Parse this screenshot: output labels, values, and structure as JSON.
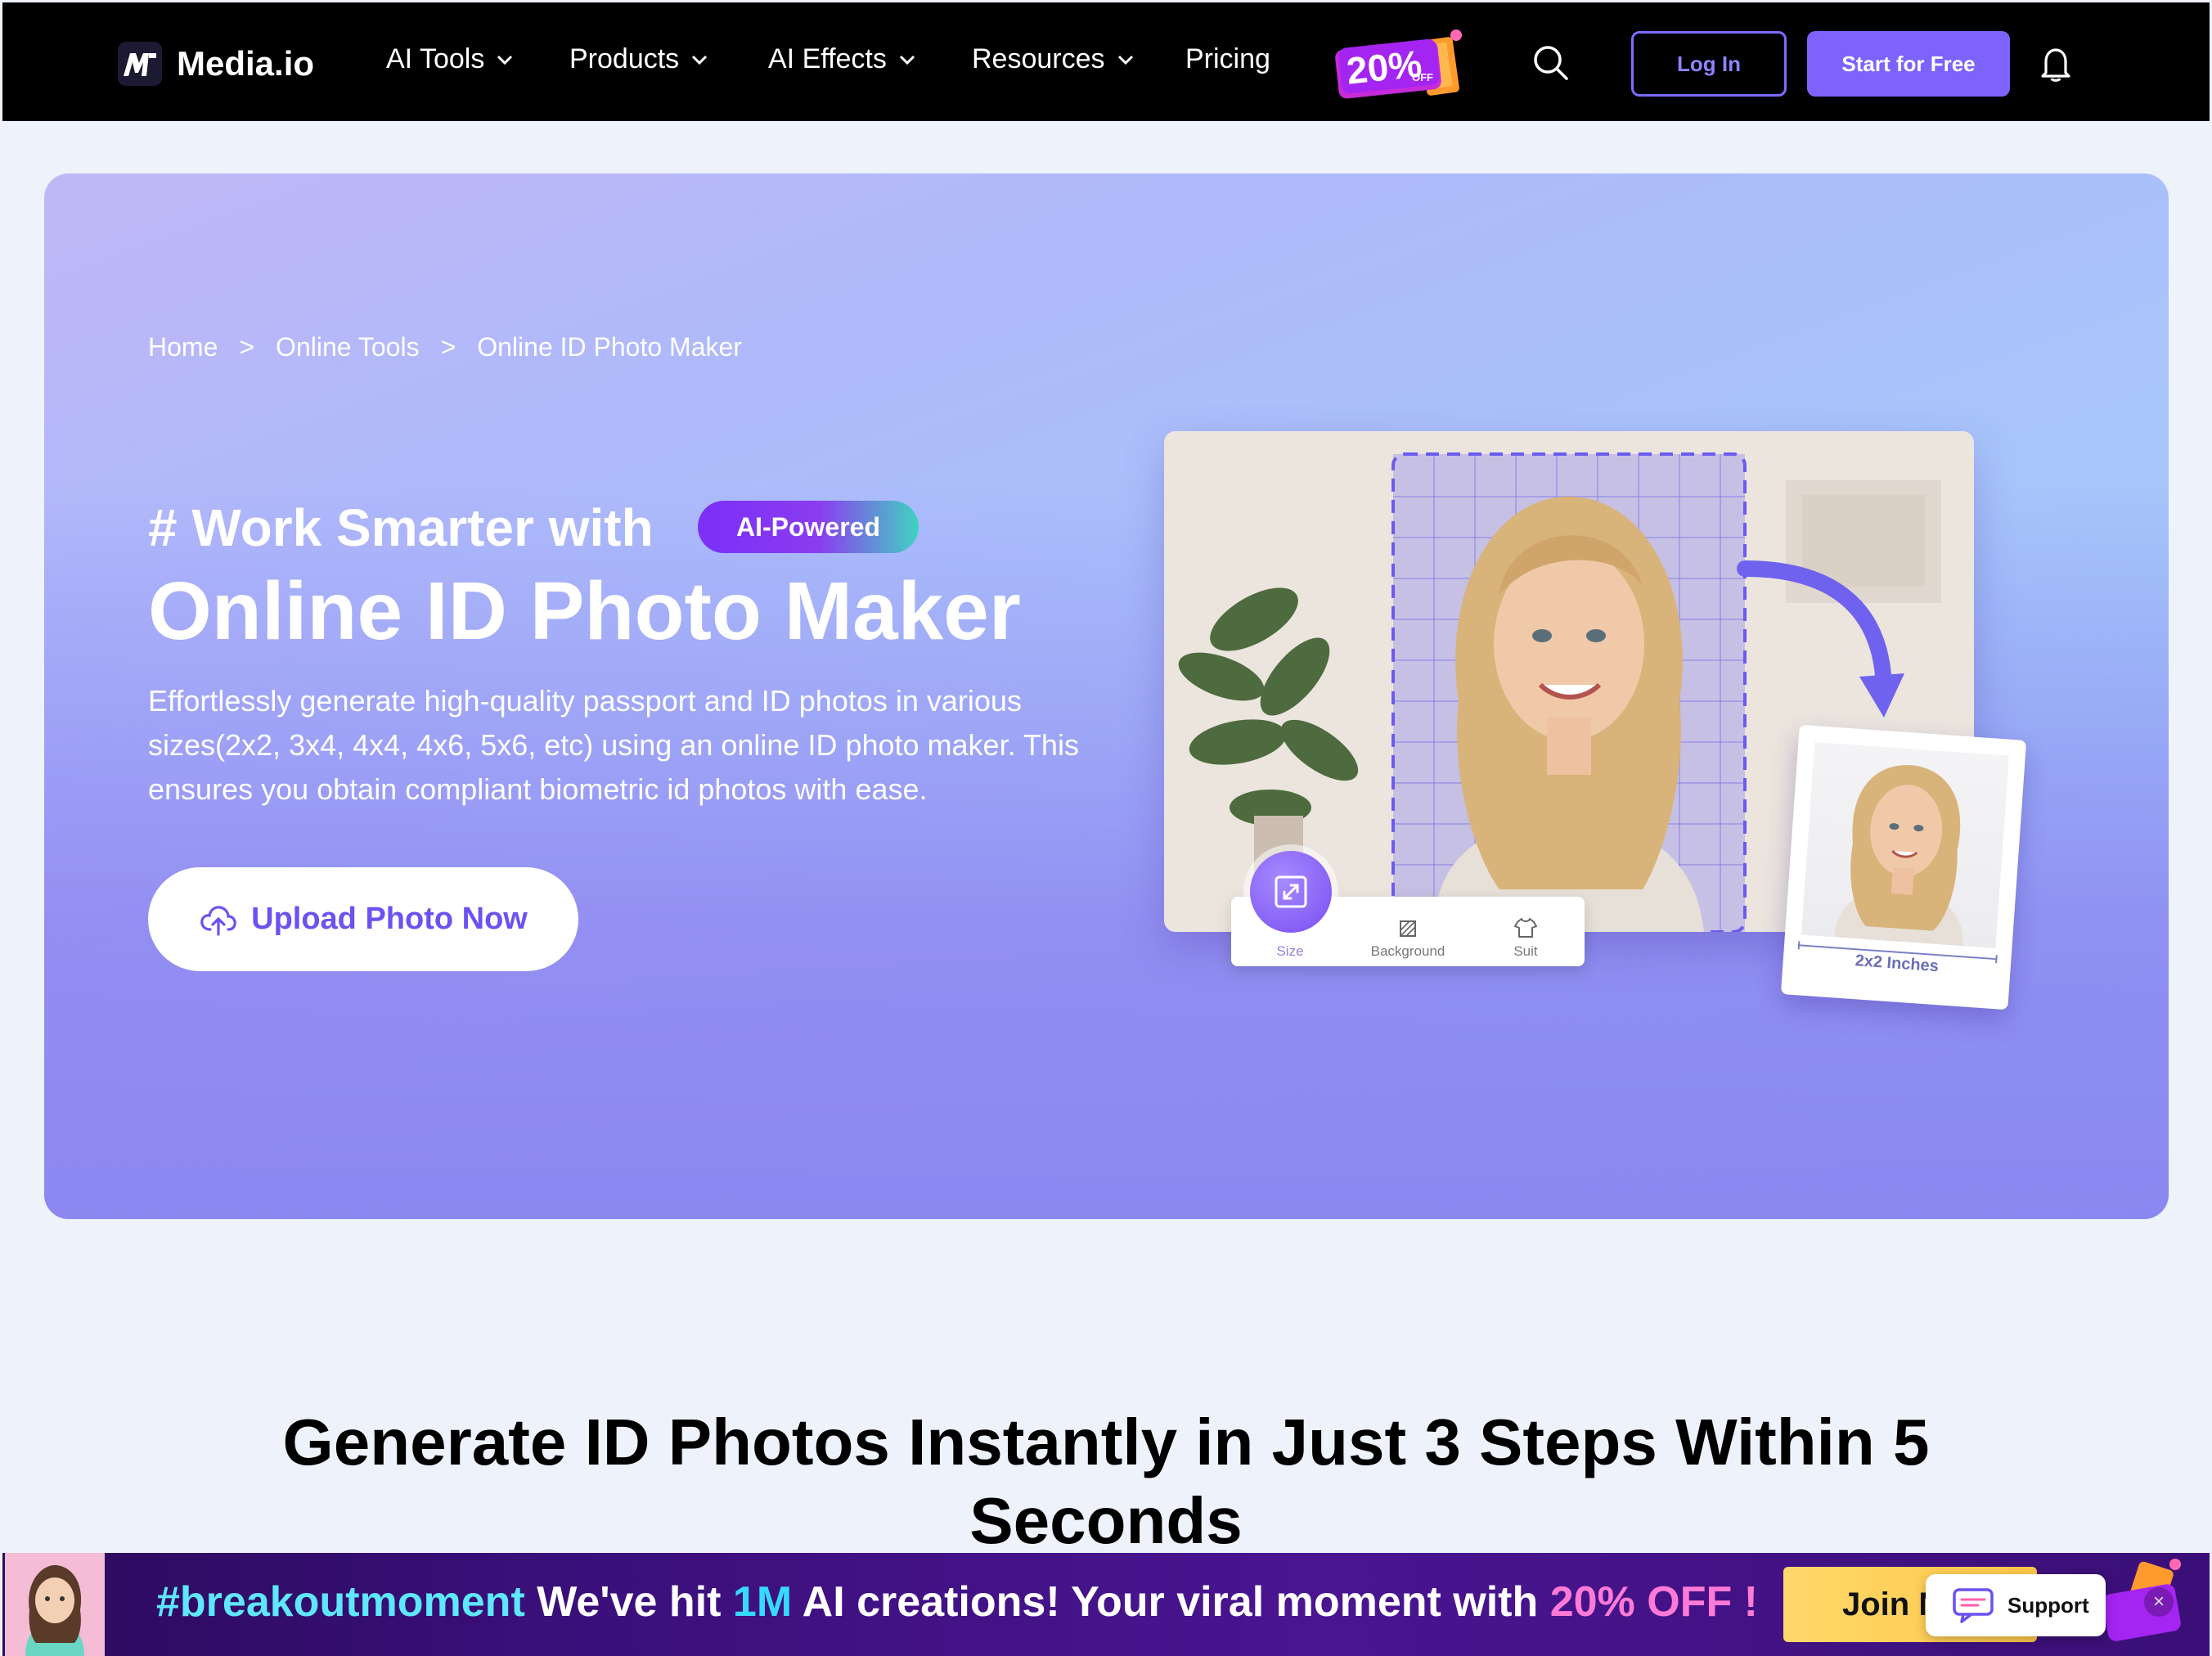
{
  "nav": {
    "logo_text": "Media.io",
    "items": [
      {
        "label": "AI Tools",
        "has_dropdown": true
      },
      {
        "label": "Products",
        "has_dropdown": true
      },
      {
        "label": "AI Effects",
        "has_dropdown": true
      },
      {
        "label": "Resources",
        "has_dropdown": true
      },
      {
        "label": "Pricing",
        "has_dropdown": false
      }
    ],
    "promo": {
      "percent": "20%",
      "off": "OFF"
    },
    "login_label": "Log In",
    "start_label": "Start for Free",
    "icons": [
      "search-icon",
      "bell-icon"
    ]
  },
  "hero": {
    "breadcrumb": [
      "Home",
      "Online Tools",
      "Online ID Photo Maker"
    ],
    "breadcrumb_sep": ">",
    "kicker": "# Work Smarter with",
    "badge": "AI-Powered",
    "title": "Online ID Photo Maker",
    "description": "Effortlessly generate high-quality passport and ID photos in various sizes(2x2, 3x4, 4x4, 4x6, 5x6, etc) using an online ID photo maker. This ensures you obtain compliant biometric id photos with ease.",
    "upload_label": "Upload Photo Now",
    "illustration": {
      "tools": [
        "Size",
        "Background",
        "Suit"
      ],
      "active_tool": "Size",
      "result_label": "2x2 Inches"
    }
  },
  "steps": {
    "title": "Generate ID Photos Instantly in Just 3 Steps Within 5 Seconds"
  },
  "banner": {
    "tag": "#breakoutmoment",
    "text_a": " We've hit ",
    "highlight_1m": "1M",
    "text_b": " AI creations! Your viral moment with ",
    "highlight_off": "20% OFF !",
    "join_label": "Join N",
    "support_label": "Support",
    "close_glyph": "×"
  },
  "colors": {
    "accent": "#7d63fb",
    "nav_bg": "#000000",
    "hero_start": "#c1b8f6",
    "hero_end": "#93cdf9",
    "banner_bg": "#3a0f7a"
  }
}
